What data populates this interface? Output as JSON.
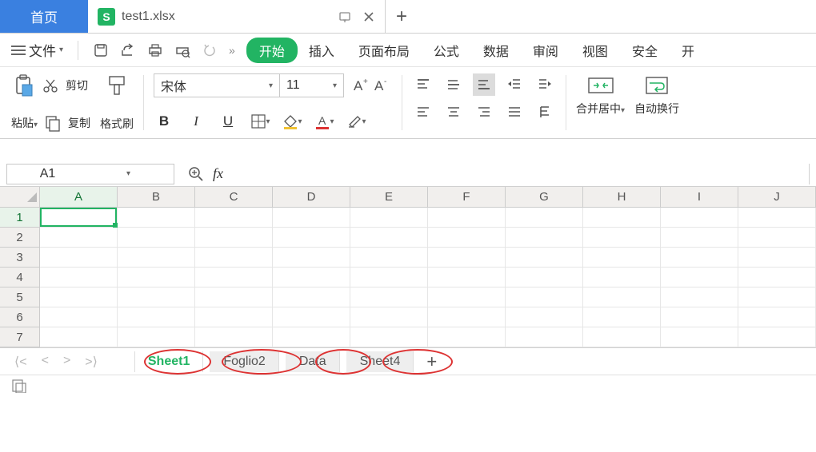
{
  "topTabs": {
    "home": "首页",
    "fileName": "test1.xlsx",
    "fileIconLetter": "S"
  },
  "menu": {
    "fileLabel": "文件",
    "start": "开始",
    "items": [
      "插入",
      "页面布局",
      "公式",
      "数据",
      "审阅",
      "视图",
      "安全",
      "开"
    ]
  },
  "ribbon": {
    "paste": "粘贴",
    "cut": "剪切",
    "copy": "复制",
    "formatPainter": "格式刷",
    "fontName": "宋体",
    "fontSize": "11",
    "bold": "B",
    "italic": "I",
    "underline": "U",
    "mergeCenter": "合并居中",
    "autoWrap": "自动换行"
  },
  "nameBox": "A1",
  "fxLabel": "fx",
  "columns": [
    "A",
    "B",
    "C",
    "D",
    "E",
    "F",
    "G",
    "H",
    "I",
    "J"
  ],
  "rows": [
    "1",
    "2",
    "3",
    "4",
    "5",
    "6",
    "7"
  ],
  "sheetTabs": [
    "Sheet1",
    "Foglio2",
    "Data",
    "Sheet4"
  ],
  "colors": {
    "accent": "#22b463",
    "blue": "#3a80e0",
    "red": "#d33"
  }
}
